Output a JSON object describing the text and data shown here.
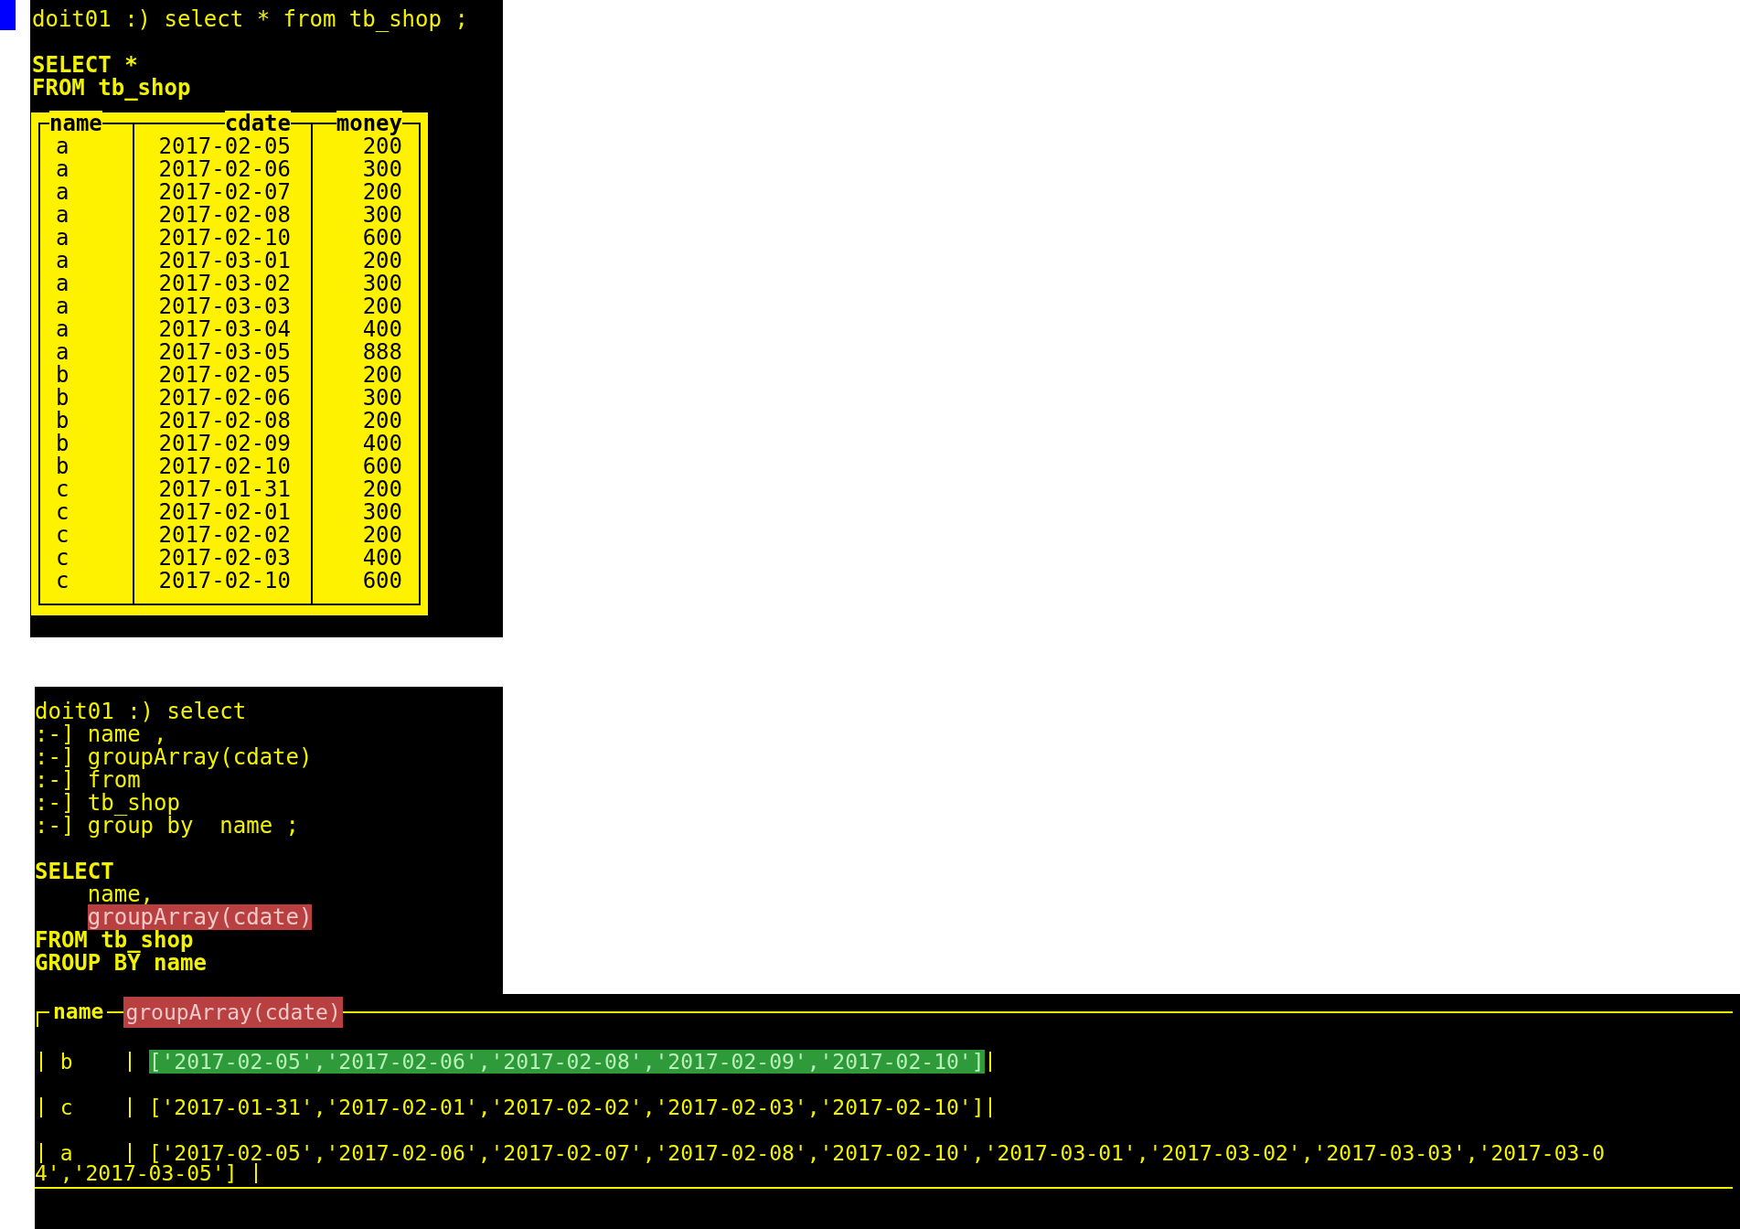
{
  "first_query": {
    "prompt": "doit01 :) select * from tb_shop ;",
    "formatted": [
      "SELECT *",
      "FROM tb_shop"
    ],
    "table": {
      "columns": [
        "name",
        "cdate",
        "money"
      ],
      "rows": [
        [
          "a",
          "2017-02-05",
          "200"
        ],
        [
          "a",
          "2017-02-06",
          "300"
        ],
        [
          "a",
          "2017-02-07",
          "200"
        ],
        [
          "a",
          "2017-02-08",
          "300"
        ],
        [
          "a",
          "2017-02-10",
          "600"
        ],
        [
          "a",
          "2017-03-01",
          "200"
        ],
        [
          "a",
          "2017-03-02",
          "300"
        ],
        [
          "a",
          "2017-03-03",
          "200"
        ],
        [
          "a",
          "2017-03-04",
          "400"
        ],
        [
          "a",
          "2017-03-05",
          "888"
        ],
        [
          "b",
          "2017-02-05",
          "200"
        ],
        [
          "b",
          "2017-02-06",
          "300"
        ],
        [
          "b",
          "2017-02-08",
          "200"
        ],
        [
          "b",
          "2017-02-09",
          "400"
        ],
        [
          "b",
          "2017-02-10",
          "600"
        ],
        [
          "c",
          "2017-01-31",
          "200"
        ],
        [
          "c",
          "2017-02-01",
          "300"
        ],
        [
          "c",
          "2017-02-02",
          "200"
        ],
        [
          "c",
          "2017-02-03",
          "400"
        ],
        [
          "c",
          "2017-02-10",
          "600"
        ]
      ]
    }
  },
  "second_query": {
    "prompt_lines": [
      "doit01 :) select",
      ":-] name ,",
      ":-] groupArray(cdate)",
      ":-] from",
      ":-] tb_shop",
      ":-] group by  name ;"
    ],
    "formatted": [
      {
        "text": "SELECT",
        "keyword": true,
        "highlight": false
      },
      {
        "text": "    name,",
        "keyword": false,
        "highlight": false
      },
      {
        "text": "groupArray(cdate)",
        "keyword": false,
        "highlight": true
      },
      {
        "text": "FROM tb_shop",
        "keyword": true,
        "highlight": false
      },
      {
        "text": "GROUP BY name",
        "keyword": true,
        "highlight": false
      }
    ],
    "result": {
      "columns": [
        {
          "label": "name",
          "highlight": false
        },
        {
          "label": "groupArray(cdate)",
          "highlight": true
        }
      ],
      "rows": [
        {
          "name": "b",
          "value": "['2017-02-05','2017-02-06','2017-02-08','2017-02-09','2017-02-10']",
          "selected": true
        },
        {
          "name": "c",
          "value": "['2017-01-31','2017-02-01','2017-02-02','2017-02-03','2017-02-10']",
          "selected": false
        },
        {
          "name": "a",
          "value": "['2017-02-05','2017-02-06','2017-02-07','2017-02-08','2017-02-10','2017-03-01','2017-03-02','2017-03-03','2017-03-0",
          "wrapped": "4','2017-03-05']",
          "selected": false
        }
      ]
    }
  }
}
